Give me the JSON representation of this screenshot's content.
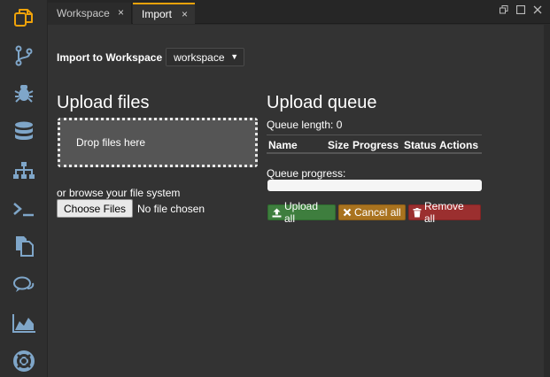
{
  "colors": {
    "background": "#2b2b2b",
    "panel": "#333333",
    "accent": "#f0a30a",
    "upload_green": "#3e7e3e",
    "cancel_orange": "#a9731f",
    "remove_red": "#9b2f2f"
  },
  "sidebar": {
    "items": [
      {
        "icon": "workspace-files-icon"
      },
      {
        "icon": "git-branch-icon"
      },
      {
        "icon": "debug-bug-icon"
      },
      {
        "icon": "database-icon"
      },
      {
        "icon": "sitemap-icon"
      },
      {
        "icon": "terminal-icon"
      },
      {
        "icon": "documents-icon"
      },
      {
        "icon": "chat-icon"
      },
      {
        "icon": "area-chart-icon"
      },
      {
        "icon": "help-lifebuoy-icon"
      }
    ]
  },
  "tabs": [
    {
      "label": "Workspace",
      "close": "×"
    },
    {
      "label": "Import",
      "close": "×"
    }
  ],
  "import_to": {
    "label": "Import to Workspace",
    "selected": "workspace",
    "caret": "▼"
  },
  "upload_files": {
    "heading": "Upload files",
    "dropzone_text": "Drop files here",
    "browse_text": "or browse your file system",
    "choose_button": "Choose Files",
    "no_file_text": "No file chosen"
  },
  "upload_queue": {
    "heading": "Upload queue",
    "length_label": "Queue length: 0",
    "columns": [
      "Name",
      "Size",
      "Progress",
      "Status",
      "Actions"
    ],
    "progress_label": "Queue progress:",
    "progress_value": 0,
    "buttons": {
      "upload_all": "Upload all",
      "cancel_all": "Cancel all",
      "remove_all": "Remove all"
    }
  }
}
